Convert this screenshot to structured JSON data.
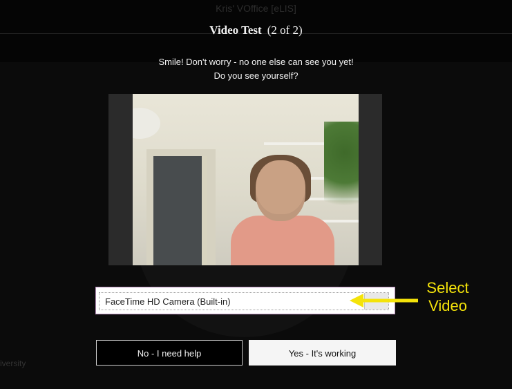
{
  "header": {
    "background_title": "Kris' VOffice [eLIS]",
    "title": "Video Test",
    "step": "(2 of 2)"
  },
  "instructions": {
    "line1": "Smile! Don't worry - no one else can see you yet!",
    "line2": "Do you see yourself?"
  },
  "camera_select": {
    "selected": "FaceTime HD Camera (Built-in)"
  },
  "annotation": {
    "line1": "Select",
    "line2": "Video",
    "color": "#f4e30a"
  },
  "buttons": {
    "no_label": "No - I need help",
    "yes_label": "Yes - It's working"
  },
  "footer": {
    "partial_text": "iversity"
  }
}
